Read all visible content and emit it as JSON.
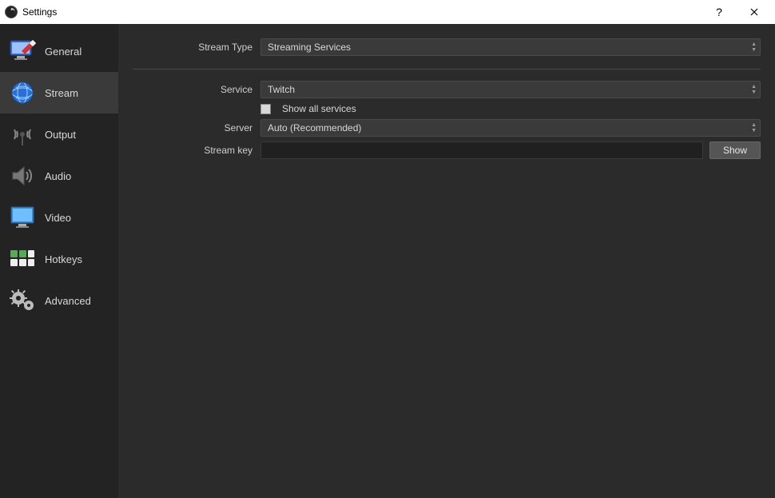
{
  "window": {
    "title": "Settings"
  },
  "sidebar": {
    "items": [
      {
        "id": "general",
        "label": "General"
      },
      {
        "id": "stream",
        "label": "Stream"
      },
      {
        "id": "output",
        "label": "Output"
      },
      {
        "id": "audio",
        "label": "Audio"
      },
      {
        "id": "video",
        "label": "Video"
      },
      {
        "id": "hotkeys",
        "label": "Hotkeys"
      },
      {
        "id": "advanced",
        "label": "Advanced"
      }
    ],
    "active": "stream"
  },
  "form": {
    "stream_type": {
      "label": "Stream Type",
      "value": "Streaming Services"
    },
    "service": {
      "label": "Service",
      "value": "Twitch"
    },
    "show_all": {
      "label": "Show all services",
      "checked": false
    },
    "server": {
      "label": "Server",
      "value": "Auto (Recommended)"
    },
    "stream_key": {
      "label": "Stream key",
      "value": "",
      "show_btn": "Show"
    }
  }
}
